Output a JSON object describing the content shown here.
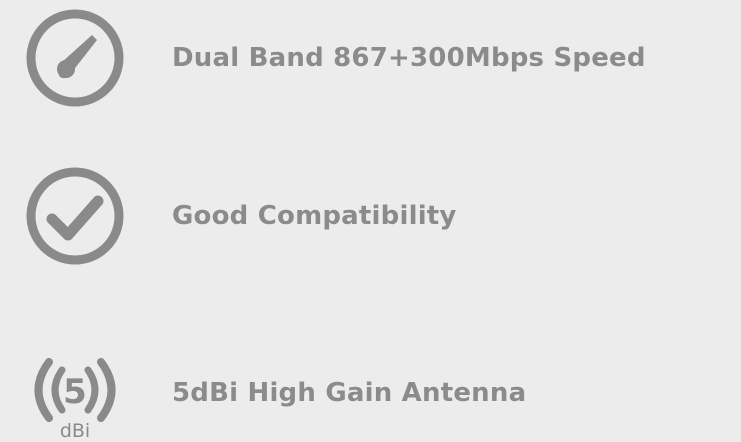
{
  "colors": {
    "background": "#ececec",
    "icon": "#8a8a8a",
    "text": "#8b8b8b"
  },
  "features": [
    {
      "icon": "speedometer-icon",
      "label": "Dual Band 867+300Mbps Speed"
    },
    {
      "icon": "checkmark-circle-icon",
      "label": "Good Compatibility"
    },
    {
      "icon": "antenna-gain-icon",
      "icon_text": "5",
      "icon_subtext": "dBi",
      "label": "5dBi High Gain Antenna"
    }
  ]
}
